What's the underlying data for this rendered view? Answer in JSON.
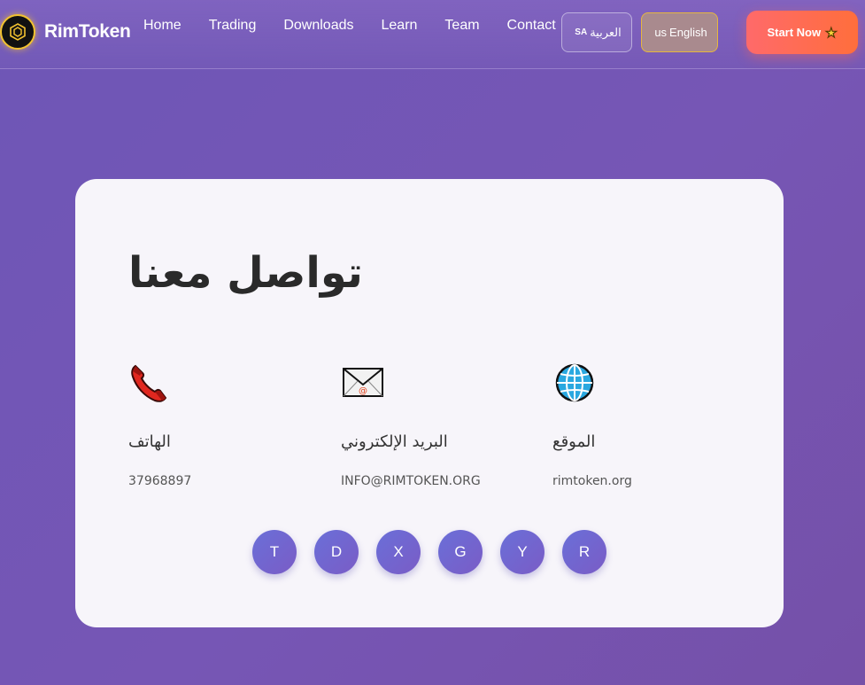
{
  "brand": {
    "name": "RimToken",
    "icon": "rimtoken-logo-icon"
  },
  "nav": {
    "links": [
      "Home",
      "Trading",
      "Downloads",
      "Learn",
      "Team",
      "Contact"
    ]
  },
  "lang": {
    "arabic": {
      "code": "SA",
      "label": "العربية"
    },
    "english": {
      "code": "us",
      "label": "English"
    }
  },
  "cta": {
    "label": "Start Now",
    "icon": "star-icon"
  },
  "contact": {
    "title": "تواصل معنا",
    "phone": {
      "icon": "phone-icon",
      "label": "الهاتف",
      "value": "37968897"
    },
    "email": {
      "icon": "envelope-icon",
      "label": "البريد الإلكتروني",
      "value": "INFO@RIMTOKEN.ORG"
    },
    "website": {
      "icon": "globe-icon",
      "label": "الموقع",
      "value": "rimtoken.org"
    }
  },
  "socials": [
    "T",
    "D",
    "X",
    "G",
    "Y",
    "R"
  ],
  "colors": {
    "background": "#7454b2",
    "accent": "#ff6a4c",
    "card": "#f7f5fa",
    "social": "#6a6fd8",
    "logo_ring": "#f2c230"
  }
}
